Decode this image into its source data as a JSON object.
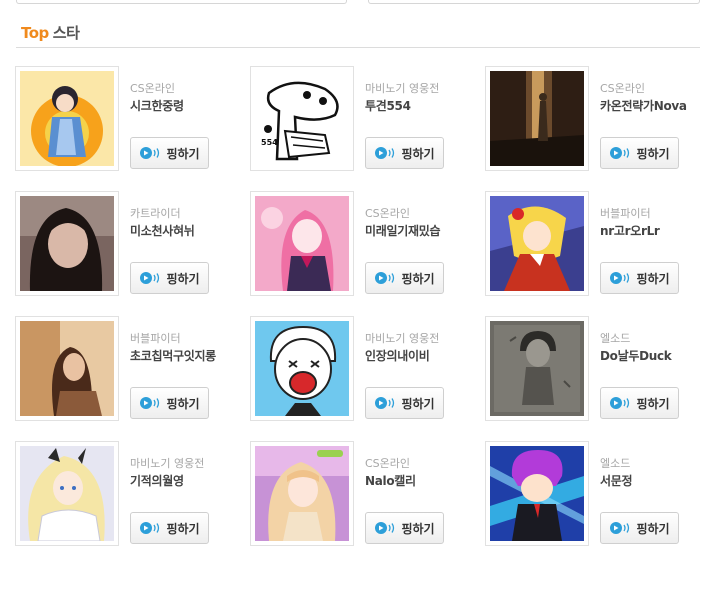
{
  "header": {
    "title_accent": "Top",
    "title_rest": "스타"
  },
  "stars": [
    {
      "category": "CS온라인",
      "name": "시크한중령",
      "button": "핑하기"
    },
    {
      "category": "마비노기 영웅전",
      "name": "투견554",
      "button": "핑하기"
    },
    {
      "category": "CS온라인",
      "name": "카온전략가Nova",
      "button": "핑하기"
    },
    {
      "category": "카트라이더",
      "name": "미소천사혀뉘",
      "button": "핑하기"
    },
    {
      "category": "CS온라인",
      "name": "미래일기재밌습",
      "button": "핑하기"
    },
    {
      "category": "버블파이터",
      "name": "nr고r오rLr",
      "button": "핑하기"
    },
    {
      "category": "버블파이터",
      "name": "초코칩먹구잇지롱",
      "button": "핑하기"
    },
    {
      "category": "마비노기 영웅전",
      "name": "인장의내이비",
      "button": "핑하기"
    },
    {
      "category": "엘소드",
      "name": "Do날두Duck",
      "button": "핑하기"
    },
    {
      "category": "마비노기 영웅전",
      "name": "기적의월영",
      "button": "핑하기"
    },
    {
      "category": "CS온라인",
      "name": "Nalo캘리",
      "button": "핑하기"
    },
    {
      "category": "엘소드",
      "name": "서문정",
      "button": "핑하기"
    }
  ],
  "icons": {
    "ping": "ping-speaker-icon"
  },
  "colors": {
    "accent": "#f08a1d",
    "ping_icon": "#2d9fd9"
  }
}
